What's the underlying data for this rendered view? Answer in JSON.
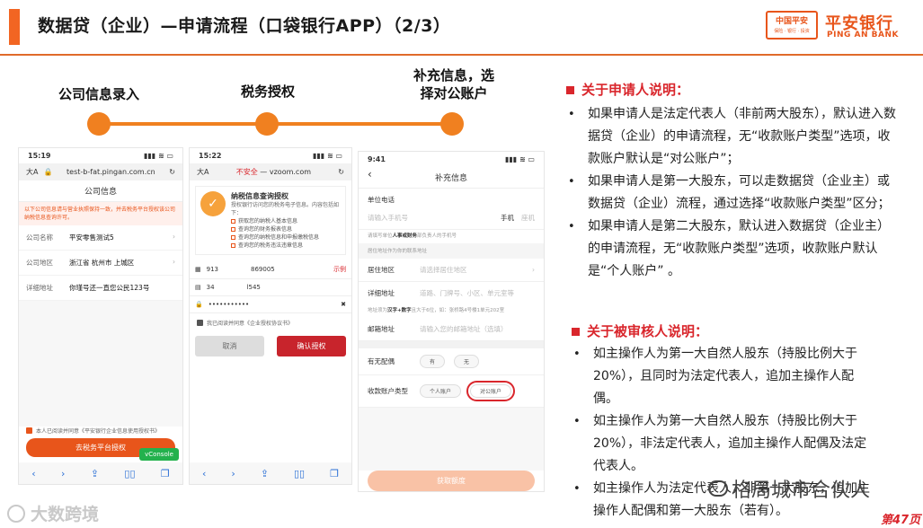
{
  "header": {
    "title": "数据贷（企业）—申请流程（口袋银行APP）（2/3）",
    "logo_top": "中国平安",
    "logo_bottom": "保险 · 银行 · 投资",
    "bank_name": "平安银行",
    "bank_en": "PING AN BANK"
  },
  "steps": [
    {
      "label": "公司信息录入"
    },
    {
      "label": "税务授权"
    },
    {
      "label": "补充信息，选\n择对公账户"
    }
  ],
  "phone1": {
    "time": "15:19",
    "signal": "▮▮▮ ≋ ▭",
    "font_size_btn": "大A",
    "url": "test-b-fat.pingan.com.cn",
    "title": "公司信息",
    "warning": "以下公司信息请与营业执照保持一致，并去税务平台授权该公司纳税信息查询许可。",
    "fields": [
      {
        "k": "公司名称",
        "v": "平安零售测试5"
      },
      {
        "k": "公司地区",
        "v": "浙江省 杭州市 上城区"
      },
      {
        "k": "详细地址",
        "v": "你瑾号还一直您公民123号"
      }
    ],
    "agree_text": "本人已阅读并同意《平安银行企业信息使用授权书》",
    "submit": "去税务平台授权",
    "vconsole": "vConsole"
  },
  "phone2": {
    "time": "15:22",
    "signal": "▮▮▮ ≋ ▭",
    "font_size_btn": "大A",
    "insecure": "不安全",
    "url": "vzoom.com",
    "auth_title": "纳税信息查询授权",
    "auth_sub": "授权银行访问您的税务电子信息。内容包括如下：",
    "auth_items": [
      "获取您的纳税人基本信息",
      "查询您的财务报表信息",
      "查询您的纳税信息和申报缴税信息",
      "查询您的税务违法违章信息"
    ],
    "field1_prefix": "913",
    "field1_value": "869005",
    "field1_action": "示例",
    "field2_prefix": "34",
    "field2_value": "l545",
    "password": "•••••••••••",
    "agree_text": "我已阅读并同意《企业授权协议书》",
    "cancel": "取消",
    "confirm": "确认授权"
  },
  "phone3": {
    "time": "9:41",
    "signal": "▮▮▮ ≋ ▭",
    "back": "‹",
    "title": "补充信息",
    "unit_phone_label": "单位电话",
    "phone_placeholder": "请输入手机号",
    "phone_opt1": "手机",
    "phone_opt2": "座机",
    "phone_hint_pre": "请填写单位",
    "phone_hint_strong": "人事或财务",
    "phone_hint_post": "部负责人的手机号",
    "residence_hint": "居住地址作为你的联系地址",
    "residence_label": "居住地区",
    "residence_ph": "请选择居住地区",
    "detail_label": "详细地址",
    "detail_ph": "道路、门牌号、小区、单元室等",
    "detail_hint_pre": "地址须为",
    "detail_hint_strong": "汉字+数字",
    "detail_hint_post": "且大于6位，如：张桥路4号楼1单元202室",
    "mail_label": "邮箱地址",
    "mail_ph": "请输入您的邮箱地址（选填）",
    "spouse_label": "有无配偶",
    "spouse_yes": "有",
    "spouse_no": "无",
    "account_label": "收款账户类型",
    "account_personal": "个人账户",
    "account_corporate": "对公账户",
    "submit": "获取额度"
  },
  "notes_applicant": {
    "heading": "关于申请人说明：",
    "items": [
      "如果申请人是法定代表人（非前两大股东），默认进入数据贷（企业）的申请流程，无“收款账户类型”选项，收款账户默认是“对公账户”；",
      "如果申请人是第一大股东，可以走数据贷（企业主）或数据贷（企业）流程，通过选择“收款账户类型”区分；",
      "如果申请人是第二大股东，默认进入数据贷（企业主）的申请流程，无“收款账户类型”选项，收款账户默认是“个人账户” 。"
    ]
  },
  "notes_reviewed": {
    "heading": "关于被审核人说明：",
    "items": [
      "如主操作人为第一大自然人股东（持股比例大于20%），且同时为法定代表人，追加主操作人配偶。",
      "如主操作人为第一大自然人股东（持股比例大于20%），非法定代表人，追加主操作人配偶及法定代表人。",
      "如主操作人为法定代表人，非第一大股东，追加主操作人配偶和第一大股东（若有）。"
    ]
  },
  "watermark_left": "大数跨境",
  "watermark_right": "格局城市合伙人",
  "page_number": "第47页",
  "colors": {
    "accent": "#f26522",
    "brand": "#e8551b",
    "red": "#d9262c"
  }
}
